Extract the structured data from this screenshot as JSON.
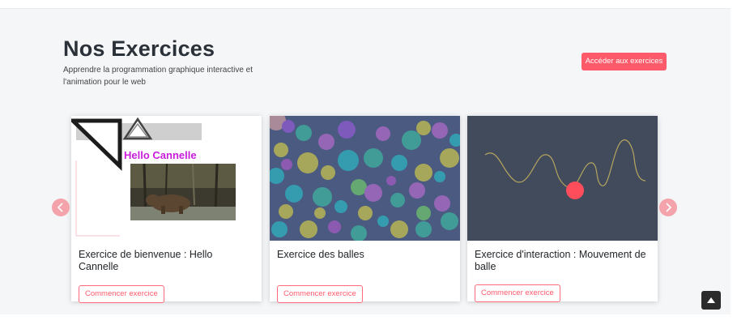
{
  "header": {
    "title": "Nos Exercices",
    "subtitle": "Apprendre la programmation graphique interactive et l'animation pour le web",
    "cta_label": "Accéder aux exercices"
  },
  "cards": [
    {
      "title": "Exercice de bienvenue : Hello Cannelle",
      "button": "Commencer exercice",
      "thumb_text": "Hello Cannelle"
    },
    {
      "title": "Exercice des balles",
      "button": "Commencer exercice"
    },
    {
      "title": "Exercice d'interaction : Mouvement de balle",
      "button": "Commencer exercice"
    }
  ],
  "icons": {
    "prev": "chevron-left-icon",
    "next": "chevron-right-icon",
    "back_to_top": "caret-up-icon"
  },
  "colors": {
    "accent": "#ff5a6a",
    "dark_panel": "#414b5c",
    "section_bg": "#f4f6f8"
  }
}
